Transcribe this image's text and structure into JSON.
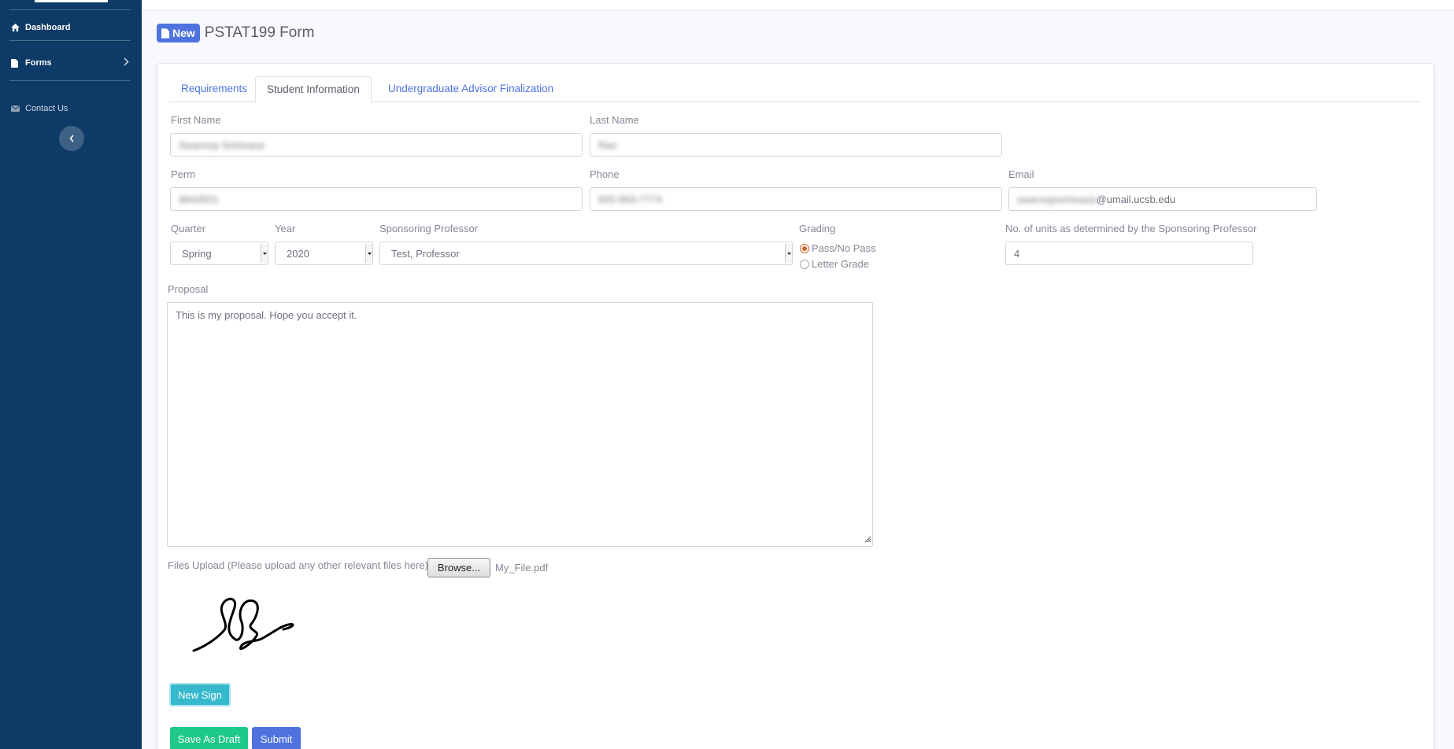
{
  "sidebar": {
    "items": [
      {
        "label": "Dashboard",
        "icon": "home-icon"
      },
      {
        "label": "Forms",
        "icon": "file-icon"
      },
      {
        "label": "Contact Us",
        "icon": "envelope-icon"
      }
    ]
  },
  "header": {
    "badge": "New",
    "title": "PSTAT199 Form"
  },
  "tabs": [
    "Requirements",
    "Student Information",
    "Undergraduate Advisor Finalization"
  ],
  "form": {
    "first_name": {
      "label": "First Name",
      "value": "Swaroop Srinivasa"
    },
    "last_name": {
      "label": "Last Name",
      "value": "Rao"
    },
    "perm": {
      "label": "Perm",
      "value": "9843551"
    },
    "phone": {
      "label": "Phone",
      "value": "805-893-7774"
    },
    "email": {
      "label": "Email",
      "value_hidden": "swaroopsrinivasa",
      "value_visible": "@umail.ucsb.edu"
    },
    "quarter": {
      "label": "Quarter",
      "value": "Spring"
    },
    "year": {
      "label": "Year",
      "value": "2020"
    },
    "professor": {
      "label": "Sponsoring Professor",
      "value": "Test, Professor"
    },
    "grading": {
      "label": "Grading",
      "options": [
        "Pass/No Pass",
        "Letter Grade"
      ],
      "selected": "Pass/No Pass"
    },
    "units": {
      "label": "No. of units as determined by the Sponsoring Professor",
      "value": "4"
    },
    "proposal": {
      "label": "Proposal",
      "value": "This is my proposal. Hope you accept it."
    },
    "upload": {
      "label": "Files Upload (Please upload any other relevant files here) :",
      "button": "Browse...",
      "filename": "My_File.pdf"
    }
  },
  "buttons": {
    "new_sign": "New Sign",
    "save_draft": "Save As Draft",
    "submit": "Submit"
  },
  "colors": {
    "sidebar": "#0d3a66",
    "primary": "#4e73df",
    "info": "#36b9cc",
    "success": "#1cc88a",
    "radio": "#d0632d"
  }
}
